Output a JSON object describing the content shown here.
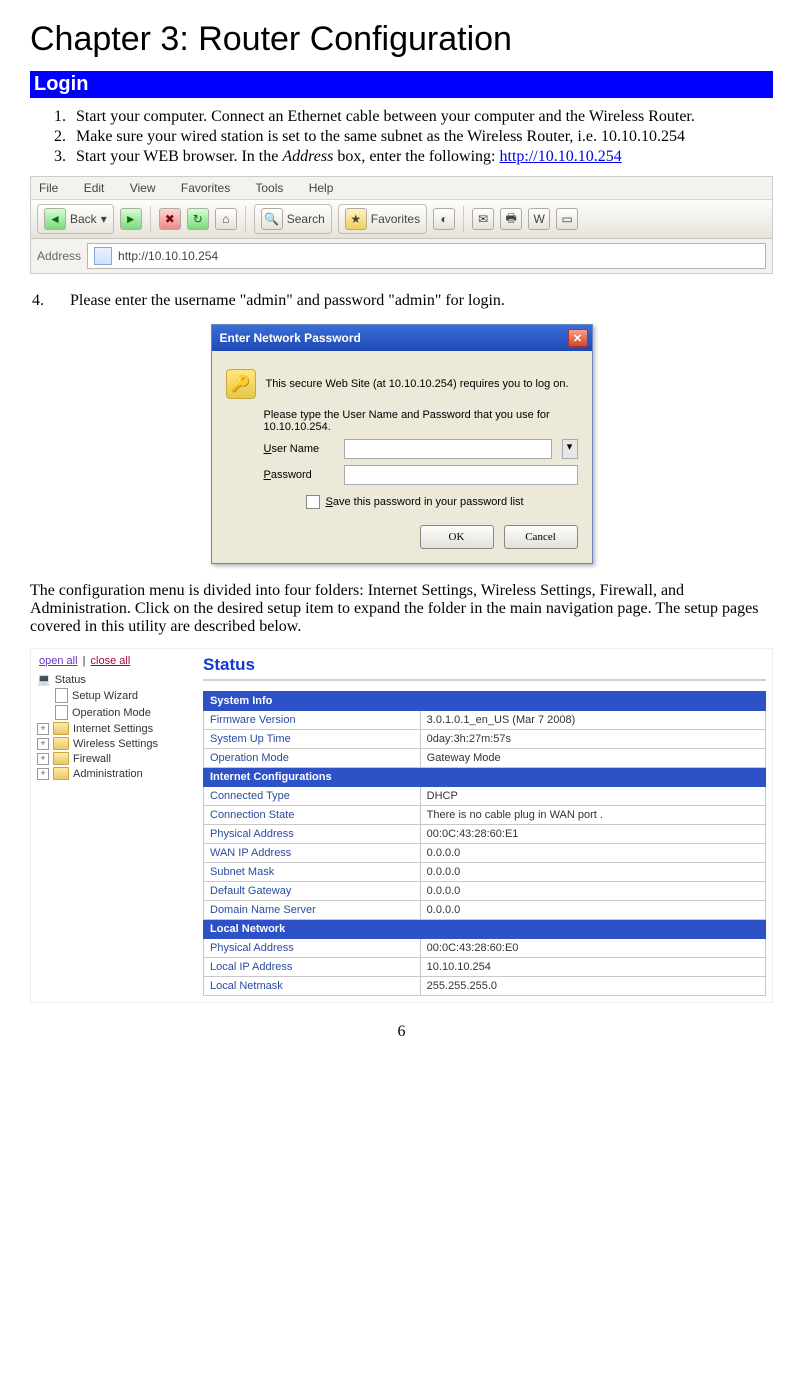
{
  "chapter_title": "Chapter 3: Router Configuration",
  "section_login": "Login",
  "steps": {
    "s1": "Start your computer. Connect an Ethernet cable between your computer and the Wireless Router.",
    "s2": "Make sure your wired station is set to the same subnet as the Wireless  Router, i.e. 10.10.10.254",
    "s3a": "Start your WEB browser. In the ",
    "s3_addressword": "Address",
    "s3b": " box, enter the following: ",
    "s3_link": "http://10.10.10.254",
    "s4_num": "4.",
    "s4": "Please enter the username \"admin\" and password \"admin\" for login."
  },
  "browser": {
    "menu": {
      "file": "File",
      "edit": "Edit",
      "view": "View",
      "fav": "Favorites",
      "tools": "Tools",
      "help": "Help"
    },
    "back": "Back",
    "search": "Search",
    "favorites": "Favorites",
    "addr_label": "Address",
    "addr_value": "http://10.10.10.254"
  },
  "dialog": {
    "title": "Enter Network Password",
    "line1": "This secure Web Site (at 10.10.10.254) requires you to log on.",
    "line2": "Please type the User Name and Password that you use for 10.10.10.254.",
    "user_label": "User Name",
    "pass_label": "Password",
    "save_label": "Save this password in your password list",
    "ok": "OK",
    "cancel": "Cancel"
  },
  "para_config": "The configuration menu is divided into four folders: Internet Settings, Wireless Settings, Firewall, and Administration. Click on the desired setup item to expand the folder in the main navigation page. The setup pages covered in this utility are described below.",
  "tree": {
    "open": "open all",
    "close": "close all",
    "sep": " | ",
    "status": "Status",
    "wizard": "Setup Wizard",
    "opmode": "Operation Mode",
    "internet": "Internet Settings",
    "wireless": "Wireless Settings",
    "firewall": "Firewall",
    "admin": "Administration"
  },
  "status": {
    "title": "Status",
    "sec_sys": "System Info",
    "fw_l": "Firmware Version",
    "fw_v": "3.0.1.0.1_en_US (Mar 7 2008)",
    "up_l": "System Up Time",
    "up_v": "0day:3h:27m:57s",
    "op_l": "Operation Mode",
    "op_v": "Gateway Mode",
    "sec_net": "Internet Configurations",
    "ct_l": "Connected Type",
    "ct_v": "DHCP",
    "cs_l": "Connection State",
    "cs_v": "There is no cable plug in WAN port .",
    "pa_l": "Physical Address",
    "pa_v": "00:0C:43:28:60:E1",
    "wip_l": "WAN IP Address",
    "wip_v": "0.0.0.0",
    "sm_l": "Subnet Mask",
    "sm_v": "0.0.0.0",
    "dg_l": "Default Gateway",
    "dg_v": "0.0.0.0",
    "dns_l": "Domain Name Server",
    "dns_v": "0.0.0.0",
    "sec_local": "Local Network",
    "lpa_l": "Physical Address",
    "lpa_v": "00:0C:43:28:60:E0",
    "lip_l": "Local IP Address",
    "lip_v": "10.10.10.254",
    "lnm_l": "Local Netmask",
    "lnm_v": "255.255.255.0"
  },
  "page_number": "6"
}
